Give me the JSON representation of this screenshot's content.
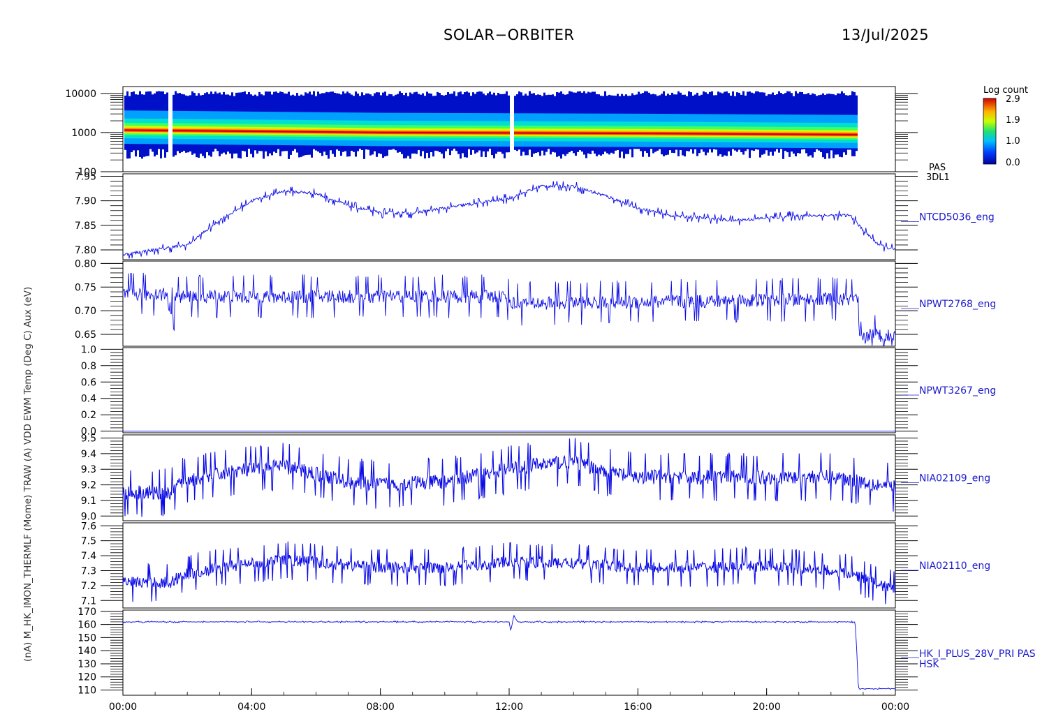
{
  "header": {
    "mission": "SOLAR−ORBITER",
    "date": "13/Jul/2025"
  },
  "colorbar": {
    "title": "Log count",
    "ticks": [
      "2.9",
      "1.9",
      "1.0",
      "0.0"
    ]
  },
  "left_axis_titles_overlapped": "(nA) M_HK_IMON_THERMLF (Mome) TRAW (A) VDD EWM Temp (Deg C) Aux (eV)",
  "chart_data": [
    {
      "type": "heatmap",
      "panel": "PAS 3DL1 energy spectrogram",
      "label": [
        "PAS",
        "3DL1"
      ],
      "yscale": "log",
      "ylim": [
        100,
        15000
      ],
      "yticks": [
        "10000",
        "1000",
        "100"
      ],
      "color_scale": {
        "title": "Log count",
        "min": 0.0,
        "max": 2.9
      },
      "energy_band": {
        "t_start_h": 0.0,
        "t_end_h": 22.8,
        "upper_eV": 10000,
        "lower_eV": 300,
        "peak_eV": [
          1150,
          1000,
          950,
          880
        ]
      },
      "gaps_h": [
        1.45,
        12.05
      ]
    },
    {
      "type": "line",
      "label": "NTCD5036_eng",
      "ylim": [
        7.78,
        7.955
      ],
      "yticks": [
        "7.95",
        "7.90",
        "7.85",
        "7.80"
      ],
      "x": [
        0,
        1,
        2,
        3,
        4,
        5,
        6,
        7,
        8,
        9,
        10,
        11,
        12,
        13,
        14,
        15,
        16,
        17,
        18,
        19,
        20,
        21,
        22,
        22.6,
        23,
        23.5,
        24
      ],
      "values": [
        7.79,
        7.8,
        7.81,
        7.86,
        7.9,
        7.92,
        7.915,
        7.89,
        7.875,
        7.875,
        7.885,
        7.895,
        7.905,
        7.93,
        7.93,
        7.91,
        7.885,
        7.87,
        7.865,
        7.86,
        7.865,
        7.87,
        7.87,
        7.87,
        7.84,
        7.81,
        7.8
      ],
      "noise": 0.004
    },
    {
      "type": "line",
      "label": "NPWT2768_eng",
      "ylim": [
        0.625,
        0.805
      ],
      "yticks": [
        "0.80",
        "0.75",
        "0.70",
        "0.65"
      ],
      "x": [
        0,
        1.4,
        1.41,
        1.6,
        1.61,
        11.9,
        12.1,
        22.8,
        22.9,
        23.2,
        24
      ],
      "values": [
        0.735,
        0.735,
        0.705,
        0.705,
        0.73,
        0.73,
        0.715,
        0.725,
        0.635,
        0.65,
        0.645
      ],
      "noise": 0.018
    },
    {
      "type": "line",
      "label": "NPWT3267_eng",
      "ylim": [
        -0.02,
        1.02
      ],
      "yticks": [
        "1.0",
        "0.8",
        "0.6",
        "0.4",
        "0.2",
        "0.0"
      ],
      "x": [
        0,
        24
      ],
      "values": [
        0.0,
        0.0
      ],
      "noise": 0.0
    },
    {
      "type": "line",
      "label": "NIA02109_eng",
      "ylim": [
        8.97,
        9.52
      ],
      "yticks": [
        "9.5",
        "9.4",
        "9.3",
        "9.2",
        "9.1",
        "9.0"
      ],
      "x": [
        0,
        1.5,
        1.8,
        3,
        4,
        5,
        6,
        7,
        8,
        10,
        12,
        13,
        14,
        15,
        16,
        18,
        20,
        22,
        23,
        24
      ],
      "values": [
        9.15,
        9.15,
        9.22,
        9.27,
        9.3,
        9.32,
        9.27,
        9.22,
        9.2,
        9.22,
        9.3,
        9.33,
        9.35,
        9.28,
        9.25,
        9.25,
        9.25,
        9.25,
        9.22,
        9.18
      ],
      "noise": 0.06
    },
    {
      "type": "line",
      "label": "NIA02110_eng",
      "ylim": [
        7.05,
        7.62
      ],
      "yticks": [
        "7.6",
        "7.5",
        "7.4",
        "7.3",
        "7.2",
        "7.1"
      ],
      "x": [
        0,
        1.5,
        1.8,
        3,
        5,
        7,
        8,
        10,
        12,
        14,
        16,
        18,
        20,
        22,
        22.8,
        23.5,
        24
      ],
      "values": [
        7.22,
        7.22,
        7.27,
        7.32,
        7.37,
        7.34,
        7.32,
        7.32,
        7.36,
        7.35,
        7.32,
        7.32,
        7.33,
        7.3,
        7.27,
        7.2,
        7.18
      ],
      "noise": 0.05
    },
    {
      "type": "line",
      "label": [
        "HK_I_PLUS_28V_PRI PAS",
        "HSK"
      ],
      "ylim": [
        106,
        171
      ],
      "yticks": [
        "170",
        "160",
        "150",
        "140",
        "130",
        "120",
        "110"
      ],
      "x": [
        0,
        12.0,
        12.05,
        12.15,
        12.25,
        22.75,
        22.8,
        22.85,
        24
      ],
      "values": [
        162,
        162,
        155,
        167,
        162,
        162,
        140,
        111,
        111
      ],
      "noise": 0.25
    }
  ],
  "x_axis": {
    "range_h": [
      0,
      24
    ],
    "ticks": [
      "00:00",
      "04:00",
      "08:00",
      "12:00",
      "16:00",
      "20:00",
      "00:00"
    ]
  }
}
